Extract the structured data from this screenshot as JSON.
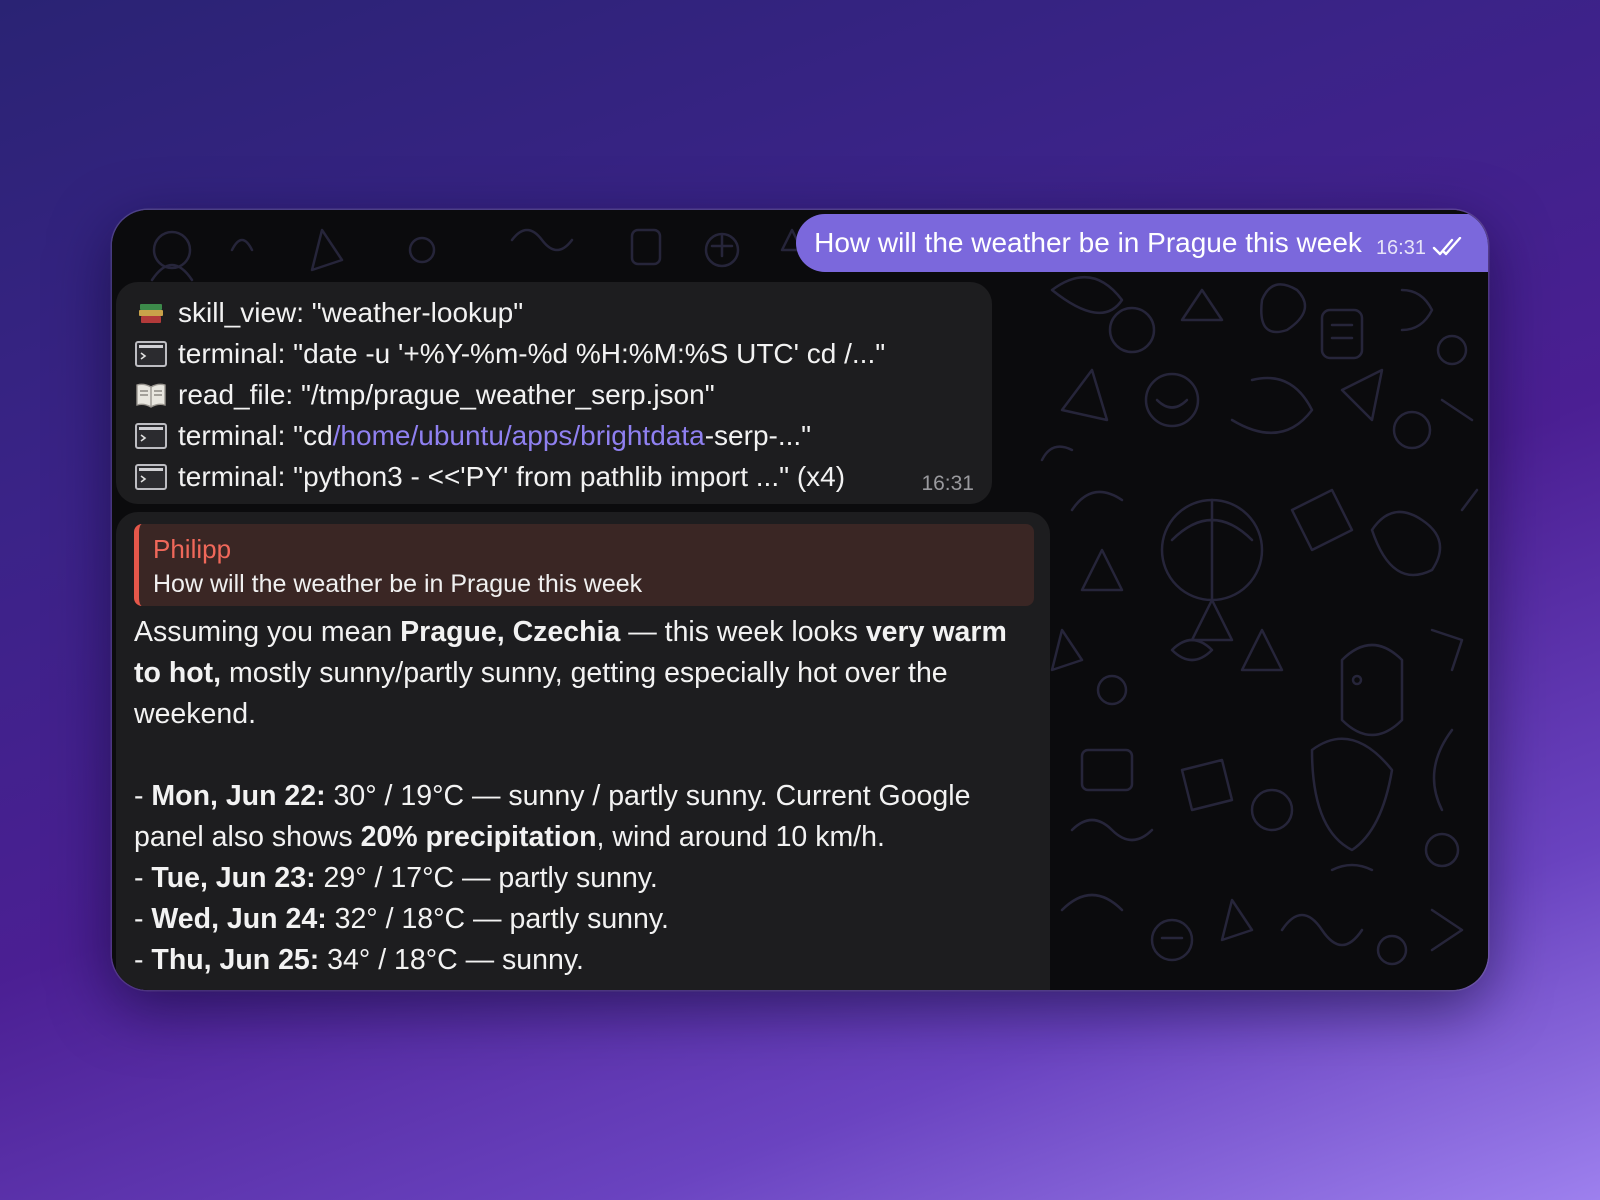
{
  "outgoing": {
    "text": "How will the weather be in Prague this week",
    "time": "16:31",
    "status_icon": "double-check-icon"
  },
  "tool_calls": {
    "time": "16:31",
    "items": [
      {
        "icon": "books-icon",
        "prefix": "skill_view: \"weather-lookup\"",
        "link": "",
        "suffix": ""
      },
      {
        "icon": "terminal-icon",
        "prefix": "terminal: \"date -u '+%Y-%m-%d %H:%M:%S UTC' cd /...\"",
        "link": "",
        "suffix": ""
      },
      {
        "icon": "open-book-icon",
        "prefix": "read_file: \"/tmp/prague_weather_serp.json\"",
        "link": "",
        "suffix": ""
      },
      {
        "icon": "terminal-icon",
        "prefix": "terminal: \"cd ",
        "link": "/home/ubuntu/apps/brightdata",
        "suffix": "-serp-...\""
      },
      {
        "icon": "terminal-icon",
        "prefix": "terminal: \"python3 - <<'PY' from pathlib import ...\" (x4)",
        "link": "",
        "suffix": ""
      }
    ]
  },
  "reply": {
    "quote_author": "Philipp",
    "quote_text": "How will the weather be in Prague this week",
    "intro": {
      "t1": "Assuming you mean ",
      "b1": "Prague, Czechia",
      "t2": " — this week looks ",
      "b2": "very warm to hot,",
      "t3": " mostly sunny/partly sunny, getting especially hot over the weekend."
    },
    "days": [
      {
        "dash": "- ",
        "day": "Mon, Jun 22:",
        "rest": " 30° / 19°C — sunny / partly sunny. Current Google panel also shows ",
        "b2": "20% precipitation",
        "rest2": ", wind around 10 km/h."
      },
      {
        "dash": "- ",
        "day": "Tue, Jun 23:",
        "rest": " 29° / 17°C — partly sunny."
      },
      {
        "dash": "- ",
        "day": "Wed, Jun 24:",
        "rest": " 32° / 18°C — partly sunny."
      },
      {
        "dash": "- ",
        "day": "Thu, Jun 25:",
        "rest": " 34° / 18°C — sunny."
      }
    ]
  },
  "colors": {
    "outgoing_bubble": "#7b68dc",
    "incoming_bubble": "#1d1d1f",
    "quote_accent": "#e5574a",
    "link": "#8f80f0"
  }
}
